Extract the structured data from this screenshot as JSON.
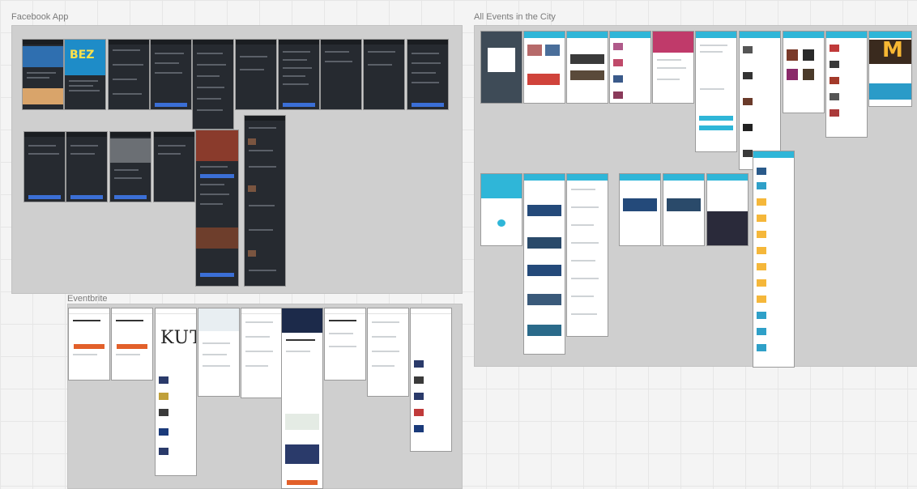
{
  "boards": {
    "facebook": {
      "label": "Facebook App"
    },
    "events": {
      "label": "All Events in the City"
    },
    "eventbrite": {
      "label": "Eventbrite"
    }
  },
  "artboard_text": {
    "bez": "BEZ",
    "kut": "KUT",
    "m": "M"
  },
  "colors": {
    "canvas": "#f4f4f4",
    "board": "#cfcfcf",
    "fb_dark": "#262a30",
    "accent_blue": "#3b6fd6",
    "events_teal": "#2fb6d8",
    "eventbrite_orange": "#e2602a"
  }
}
